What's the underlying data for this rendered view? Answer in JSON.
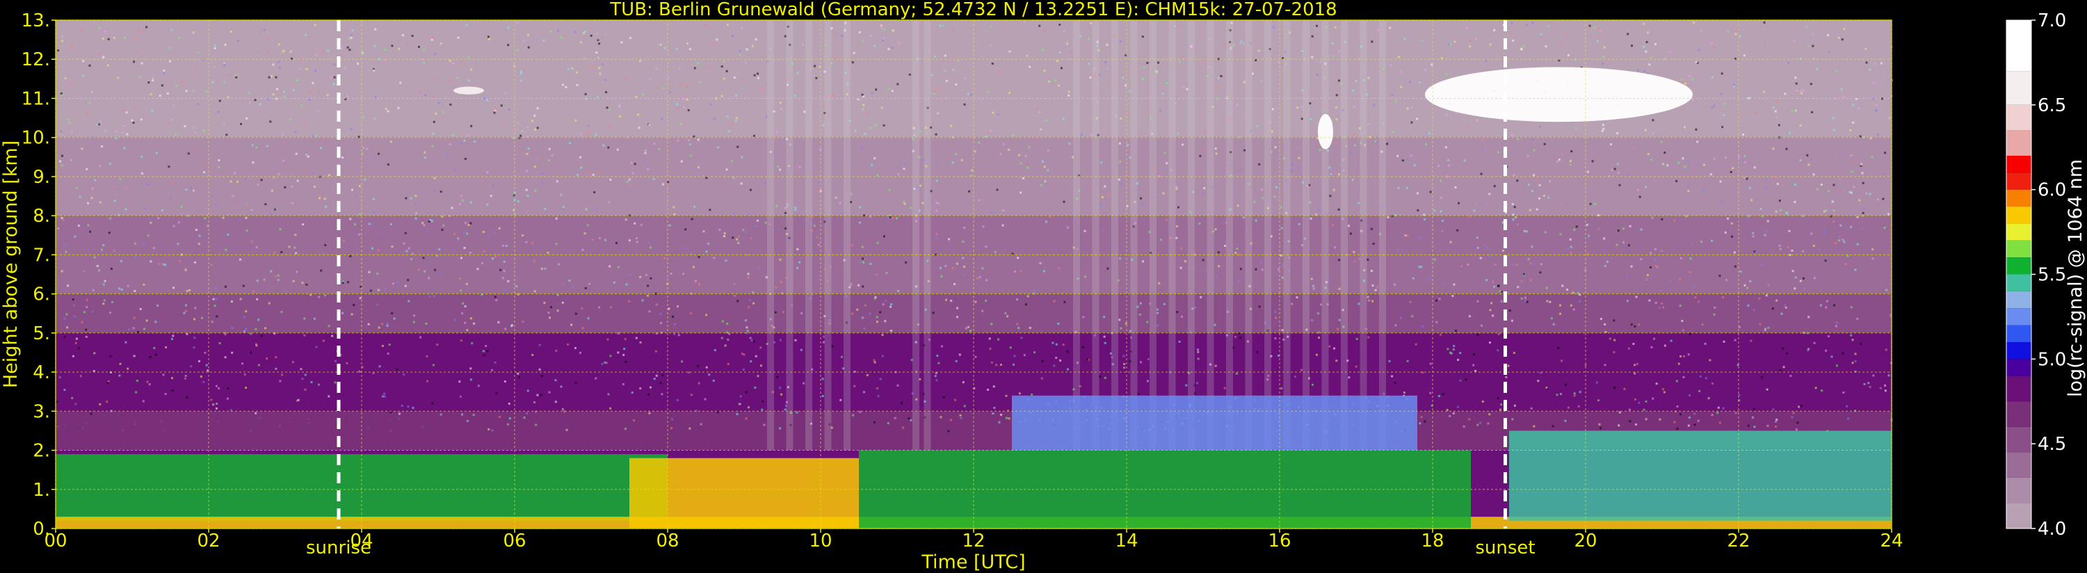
{
  "chart_data": {
    "type": "heatmap",
    "title": "TUB: Berlin Grunewald (Germany; 52.4732 N / 13.2251 E):    CHM15k: 27-07-2018",
    "xlabel": "Time [UTC]",
    "ylabel": "Height above ground [km]",
    "xlim": [
      0,
      24
    ],
    "ylim": [
      0,
      13
    ],
    "x_ticks": [
      "00",
      "02",
      "04",
      "06",
      "08",
      "10",
      "12",
      "14",
      "16",
      "18",
      "20",
      "22",
      "24"
    ],
    "x_tick_values": [
      0,
      2,
      4,
      6,
      8,
      10,
      12,
      14,
      16,
      18,
      20,
      22,
      24
    ],
    "y_ticks": [
      "0.",
      "1.",
      "2.",
      "3.",
      "4.",
      "5.",
      "6.",
      "7.",
      "8.",
      "9.",
      "10.",
      "11.",
      "12.",
      "13."
    ],
    "y_tick_values": [
      0,
      1,
      2,
      3,
      4,
      5,
      6,
      7,
      8,
      9,
      10,
      11,
      12,
      13
    ],
    "grid": true,
    "annotations": [
      {
        "label": "sunrise",
        "x": 3.7
      },
      {
        "label": "sunset",
        "x": 18.95
      }
    ],
    "colorbar": {
      "label": "log(rc-signal) @ 1064 nm",
      "range": [
        4.0,
        7.0
      ],
      "ticks": [
        "4.0",
        "4.5",
        "5.0",
        "5.5",
        "6.0",
        "6.5",
        "7.0"
      ],
      "tick_values": [
        4.0,
        4.5,
        5.0,
        5.5,
        6.0,
        6.5,
        7.0
      ],
      "levels": [
        {
          "v": 4.0,
          "color": "#b8a1b3"
        },
        {
          "v": 4.15,
          "color": "#ad8ca9"
        },
        {
          "v": 4.3,
          "color": "#9c6c98"
        },
        {
          "v": 4.45,
          "color": "#8a4f88"
        },
        {
          "v": 4.6,
          "color": "#7a3078"
        },
        {
          "v": 4.75,
          "color": "#6a1078"
        },
        {
          "v": 4.9,
          "color": "#4a00a0"
        },
        {
          "v": 5.0,
          "color": "#1010e0"
        },
        {
          "v": 5.1,
          "color": "#3058f0"
        },
        {
          "v": 5.2,
          "color": "#6a8cf0"
        },
        {
          "v": 5.3,
          "color": "#90b0e8"
        },
        {
          "v": 5.4,
          "color": "#40c0a0"
        },
        {
          "v": 5.5,
          "color": "#10b030"
        },
        {
          "v": 5.6,
          "color": "#80e040"
        },
        {
          "v": 5.7,
          "color": "#e8f030"
        },
        {
          "v": 5.8,
          "color": "#f8c800"
        },
        {
          "v": 5.9,
          "color": "#f88000"
        },
        {
          "v": 6.0,
          "color": "#f02010"
        },
        {
          "v": 6.1,
          "color": "#f80000"
        },
        {
          "v": 6.2,
          "color": "#e8a8a8"
        },
        {
          "v": 6.35,
          "color": "#f0d0d0"
        },
        {
          "v": 6.5,
          "color": "#f4eeee"
        },
        {
          "v": 6.7,
          "color": "#ffffff"
        }
      ]
    },
    "features": [
      {
        "kind": "residual_layer",
        "x": [
          0,
          5.0
        ],
        "y": [
          2.0,
          2.9
        ],
        "value": 4.7
      },
      {
        "kind": "mixed_layer",
        "x": [
          0,
          8.0
        ],
        "y": [
          0.2,
          1.9
        ],
        "value": 5.5
      },
      {
        "kind": "surface_layer",
        "x": [
          0,
          24
        ],
        "y": [
          0,
          0.3
        ],
        "value": 5.8
      },
      {
        "kind": "growing_boundary_layer",
        "x": [
          7.5,
          10.5
        ],
        "y": [
          0.0,
          1.8
        ],
        "value": 5.8
      },
      {
        "kind": "convective_layer",
        "x": [
          10.5,
          18.5
        ],
        "y": [
          0.0,
          2.0
        ],
        "value": 5.5
      },
      {
        "kind": "aerosol_top",
        "x": [
          12.5,
          17.8
        ],
        "y": [
          2.0,
          3.4
        ],
        "value": 5.2
      },
      {
        "kind": "cirrus_cloud",
        "x": [
          17.9,
          21.4
        ],
        "y": [
          10.4,
          11.8
        ],
        "value": 6.8
      },
      {
        "kind": "cloud_fragment",
        "x": [
          16.5,
          16.7
        ],
        "y": [
          9.7,
          10.6
        ],
        "value": 6.8
      },
      {
        "kind": "cloud_fragment",
        "x": [
          5.2,
          5.6
        ],
        "y": [
          11.1,
          11.3
        ],
        "value": 6.5
      },
      {
        "kind": "evening_layer",
        "x": [
          19.0,
          24
        ],
        "y": [
          0.2,
          2.5
        ],
        "value": 5.4
      }
    ],
    "noise_columns_x": [
      9.3,
      9.55,
      9.8,
      10.05,
      10.3,
      11.2,
      11.35,
      13.3,
      13.55,
      13.8,
      14.05,
      14.3,
      14.55,
      14.8,
      15.05,
      15.3,
      15.55,
      15.8,
      16.05,
      16.3,
      16.55,
      16.8,
      17.05,
      17.3
    ]
  }
}
